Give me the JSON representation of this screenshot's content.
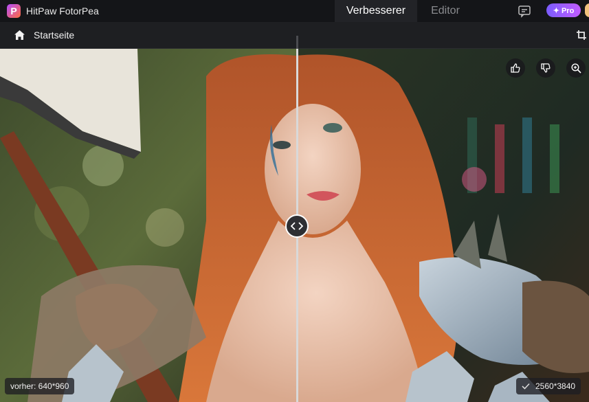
{
  "app": {
    "name": "HitPaw FotorPea",
    "logo_letter": "P"
  },
  "tabs": [
    {
      "label": "Verbesserer",
      "active": true
    },
    {
      "label": "Editor",
      "active": false
    }
  ],
  "header": {
    "pro_label": "✦ Pro"
  },
  "nav": {
    "home_label": "Startseite"
  },
  "viewer": {
    "before_label": "vorher: 640*960",
    "after_label": "2560*3840",
    "split_fraction": 0.505
  },
  "colors": {
    "accent_purple": "#8b5cff",
    "titlebar_bg": "#141518",
    "navbar_bg": "#1e1f22"
  },
  "icons": {
    "home": "home-icon",
    "chat": "chat-icon",
    "crop": "crop-icon",
    "like": "thumbs-up-icon",
    "dislike": "thumbs-down-icon",
    "zoom": "zoom-in-icon",
    "compare": "compare-arrows-icon",
    "check": "check-icon"
  }
}
